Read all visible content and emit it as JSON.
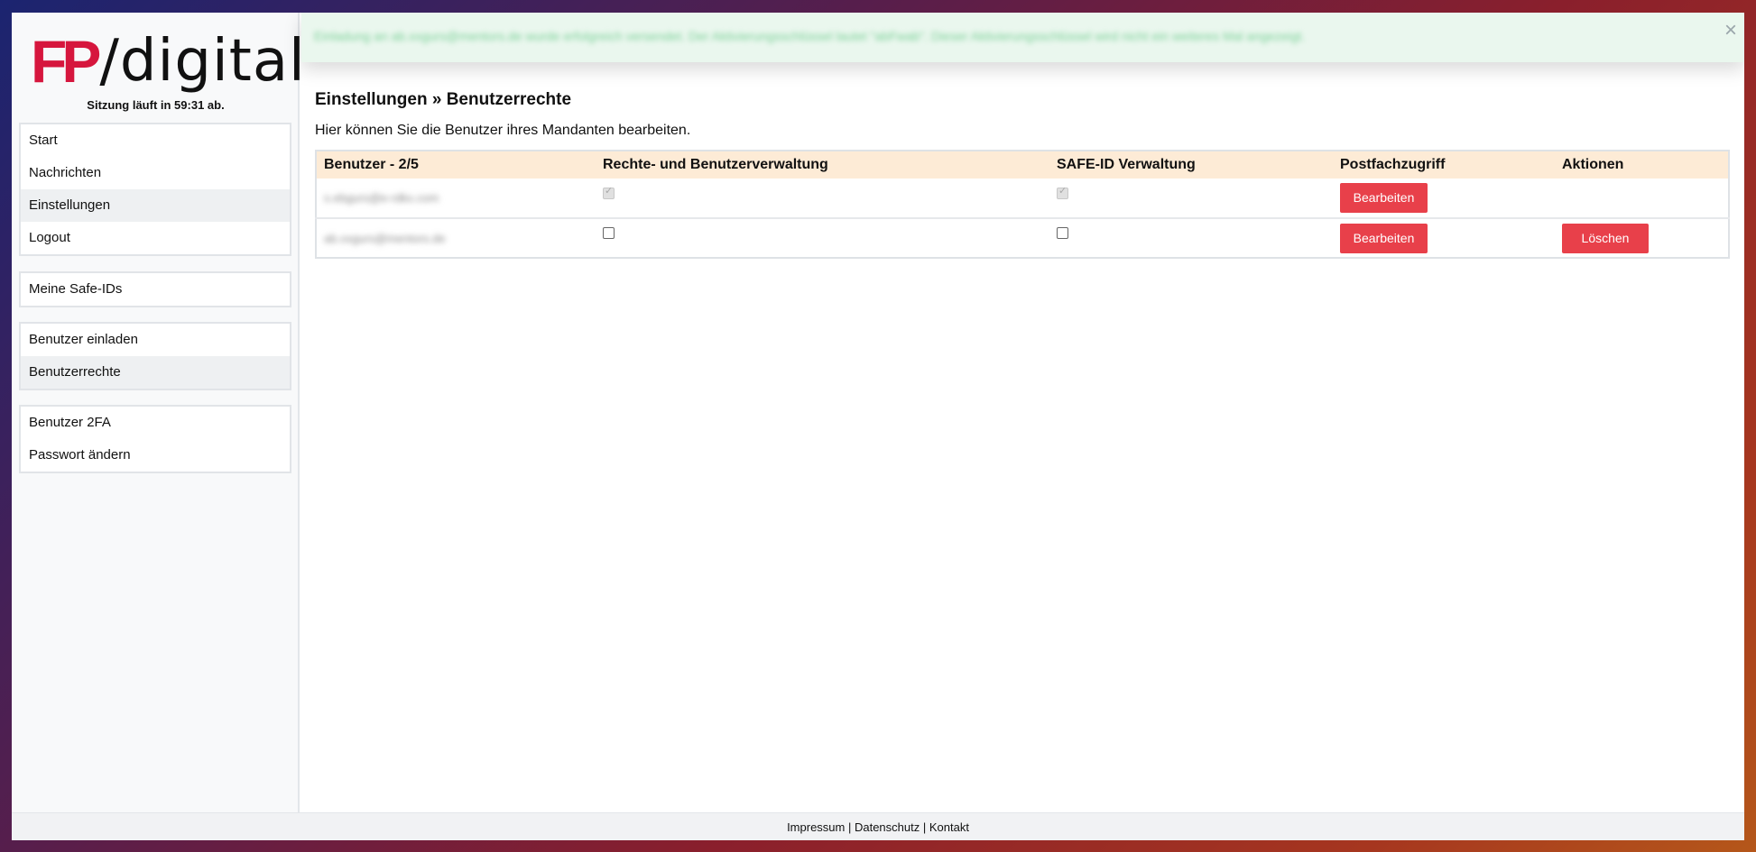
{
  "logo": {
    "mark": "FP",
    "text": "/digital"
  },
  "session": {
    "text": "Sitzung läuft in 59:31 ab."
  },
  "sidebar": {
    "groups": [
      {
        "items": [
          {
            "label": "Start",
            "active": false
          },
          {
            "label": "Nachrichten",
            "active": false
          },
          {
            "label": "Einstellungen",
            "active": true
          },
          {
            "label": "Logout",
            "active": false
          }
        ]
      },
      {
        "items": [
          {
            "label": "Meine Safe-IDs",
            "active": false
          }
        ]
      },
      {
        "items": [
          {
            "label": "Benutzer einladen",
            "active": false
          },
          {
            "label": "Benutzerrechte",
            "active": true
          }
        ]
      },
      {
        "items": [
          {
            "label": "Benutzer 2FA",
            "active": false
          },
          {
            "label": "Passwort ändern",
            "active": false
          }
        ]
      }
    ]
  },
  "alert": {
    "text": "Einladung an ab.xxgurs@mentors.de wurde erfolgreich versendet. Der Aktivierungsschlüssel lautet \"abFwab\". Dieser Aktivierungsschlüssel wird nicht ein weiteres Mal angezeigt.",
    "close_icon": "close-icon"
  },
  "main": {
    "title": "Einstellungen » Benutzerrechte",
    "description": "Hier können Sie die Benutzer ihres Mandanten bearbeiten."
  },
  "table": {
    "headers": [
      "Benutzer - 2/5",
      "Rechte- und Benutzerverwaltung",
      "SAFE-ID Verwaltung",
      "Postfachzugriff",
      "Aktionen"
    ],
    "rows": [
      {
        "email": "s.ebgurs@e-rdkx.com",
        "rights": true,
        "rights_disabled": true,
        "safeid": true,
        "safeid_disabled": true,
        "edit_label": "Bearbeiten",
        "delete_label": null
      },
      {
        "email": "ab.xxgurs@mentors.de",
        "rights": false,
        "rights_disabled": false,
        "safeid": false,
        "safeid_disabled": false,
        "edit_label": "Bearbeiten",
        "delete_label": "Löschen"
      }
    ]
  },
  "footer": {
    "links": [
      "Impressum",
      "Datenschutz",
      "Kontakt"
    ],
    "separator": " | "
  },
  "colors": {
    "brand": "#d6163d",
    "button": "#e8404a",
    "table_header": "#fdebd6",
    "alert_bg": "#eaf7ee"
  }
}
